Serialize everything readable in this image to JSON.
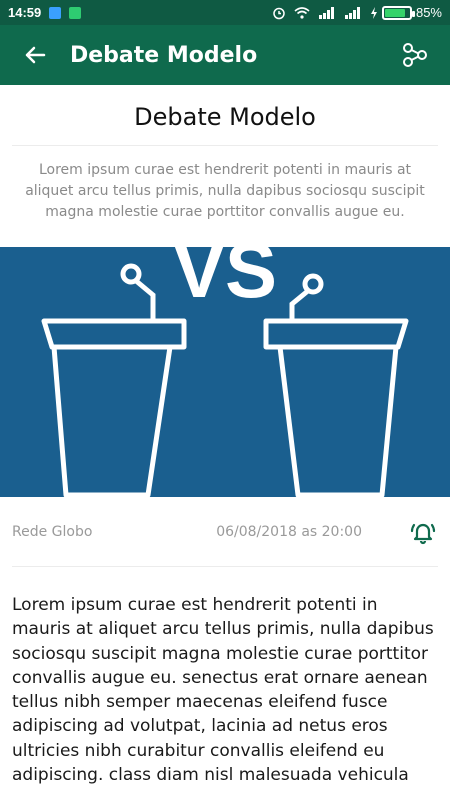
{
  "status_bar": {
    "time": "14:59",
    "battery_percent": "85%",
    "battery_level": 0.85,
    "icons": [
      "vpn-icon",
      "android-icon",
      "alarm-clock-icon",
      "wifi-icon",
      "signal-icon",
      "signal-icon",
      "charging-icon"
    ]
  },
  "app_bar": {
    "title": "Debate Modelo",
    "back_icon": "arrow-left-icon",
    "share_icon": "share-icon"
  },
  "article": {
    "title": "Debate Modelo",
    "summary": "Lorem ipsum curae est hendrerit potenti in mauris at aliquet arcu tellus primis, nulla dapibus sociosqu suscipit magna molestie curae porttitor convallis augue eu.",
    "hero_text": "VS",
    "channel": "Rede Globo",
    "datetime": "06/08/2018 as 20:00",
    "alarm_icon": "alarm-bell-icon",
    "body": "Lorem ipsum curae est hendrerit potenti in mauris at aliquet arcu tellus primis, nulla dapibus sociosqu suscipit magna molestie curae porttitor convallis augue eu. senectus erat ornare aenean tellus nibh semper maecenas eleifend fusce adipiscing ad volutpat, lacinia ad netus eros ultricies nibh curabitur convallis eleifend eu adipiscing. class diam nisl malesuada vehicula"
  },
  "colors": {
    "status_bar": "#0f5a43",
    "app_bar": "#0f6a4d",
    "hero_background": "#1a5f8f",
    "accent_green": "#0f6a4d"
  }
}
